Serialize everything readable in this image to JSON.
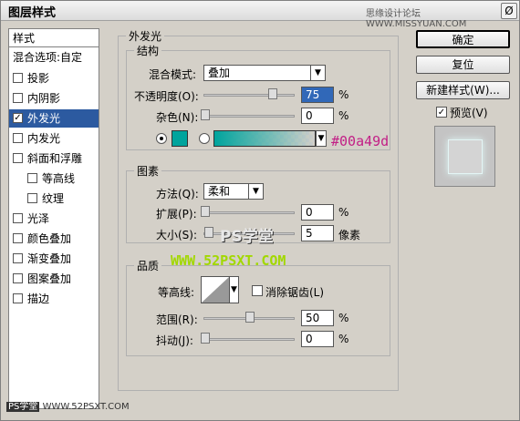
{
  "window": {
    "title": "图层样式",
    "watermark": "思缘设计论坛 WWW.MISSYUAN.COM",
    "close_label": "Ø"
  },
  "left_list": {
    "header": "样式",
    "blend_options": "混合选项:自定",
    "items": [
      {
        "label": "投影",
        "checked": false
      },
      {
        "label": "内阴影",
        "checked": false
      },
      {
        "label": "外发光",
        "checked": true,
        "selected": true
      },
      {
        "label": "内发光",
        "checked": false
      },
      {
        "label": "斜面和浮雕",
        "checked": false
      },
      {
        "label": "等高线",
        "checked": false
      },
      {
        "label": "纹理",
        "checked": false
      },
      {
        "label": "光泽",
        "checked": false
      },
      {
        "label": "颜色叠加",
        "checked": false
      },
      {
        "label": "渐变叠加",
        "checked": false
      },
      {
        "label": "图案叠加",
        "checked": false
      },
      {
        "label": "描边",
        "checked": false
      }
    ]
  },
  "outer_glow": {
    "group_title": "外发光",
    "structure": {
      "title": "结构",
      "blend_mode_label": "混合模式:",
      "blend_mode_value": "叠加",
      "opacity_label": "不透明度(O):",
      "opacity_value": "75",
      "opacity_unit": "%",
      "noise_label": "杂色(N):",
      "noise_value": "0",
      "noise_unit": "%",
      "color_hex": "#00a49d",
      "color_annotation": "#00a49d"
    },
    "elements": {
      "title": "图素",
      "technique_label": "方法(Q):",
      "technique_value": "柔和",
      "spread_label": "扩展(P):",
      "spread_value": "0",
      "spread_unit": "%",
      "size_label": "大小(S):",
      "size_value": "5",
      "size_unit": "像素"
    },
    "quality": {
      "title": "品质",
      "contour_label": "等高线:",
      "anti_alias_label": "消除锯齿(L)",
      "range_label": "范围(R):",
      "range_value": "50",
      "range_unit": "%",
      "jitter_label": "抖动(J):",
      "jitter_value": "0",
      "jitter_unit": "%"
    }
  },
  "buttons": {
    "ok": "确定",
    "reset": "复位",
    "new_style": "新建样式(W)...",
    "preview_label": "预览(V)"
  },
  "overlay": {
    "ps_title": "PS学堂",
    "ps_url": "WWW.52PSXT.COM",
    "footer_title": "PS学堂",
    "footer_url": "WWW.52PSXT.COM"
  }
}
